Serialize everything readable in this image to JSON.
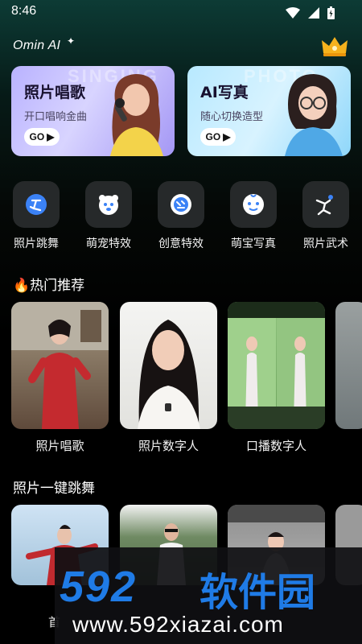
{
  "status": {
    "time": "8:46"
  },
  "app": {
    "brand": "Omin AI"
  },
  "banners": [
    {
      "title": "照片唱歌",
      "subtitle": "开口唱响金曲",
      "go": "GO",
      "bgword": "SINGING"
    },
    {
      "title": "AI写真",
      "subtitle": "随心切换造型",
      "go": "GO",
      "bgword": "PHOTO"
    }
  ],
  "quick_actions": [
    {
      "label": "照片跳舞",
      "icon": "dance-icon"
    },
    {
      "label": "萌宠特效",
      "icon": "pet-icon"
    },
    {
      "label": "创意特效",
      "icon": "creative-icon"
    },
    {
      "label": "萌宝写真",
      "icon": "baby-icon"
    },
    {
      "label": "照片武术",
      "icon": "martial-arts-icon"
    }
  ],
  "hot": {
    "title": "热门推荐",
    "cards": [
      {
        "label": "照片唱歌"
      },
      {
        "label": "照片数字人"
      },
      {
        "label": "口播数字人"
      }
    ]
  },
  "dance": {
    "title": "照片一键跳舞",
    "cards": [
      {
        "label": "首"
      }
    ]
  },
  "watermark": {
    "logo": "592",
    "name": "软件园",
    "url": "www.592xiazai.com"
  },
  "colors": {
    "accent": "#1f7be6",
    "banner1": "#b9b2ff",
    "banner2": "#b8e9ff"
  }
}
